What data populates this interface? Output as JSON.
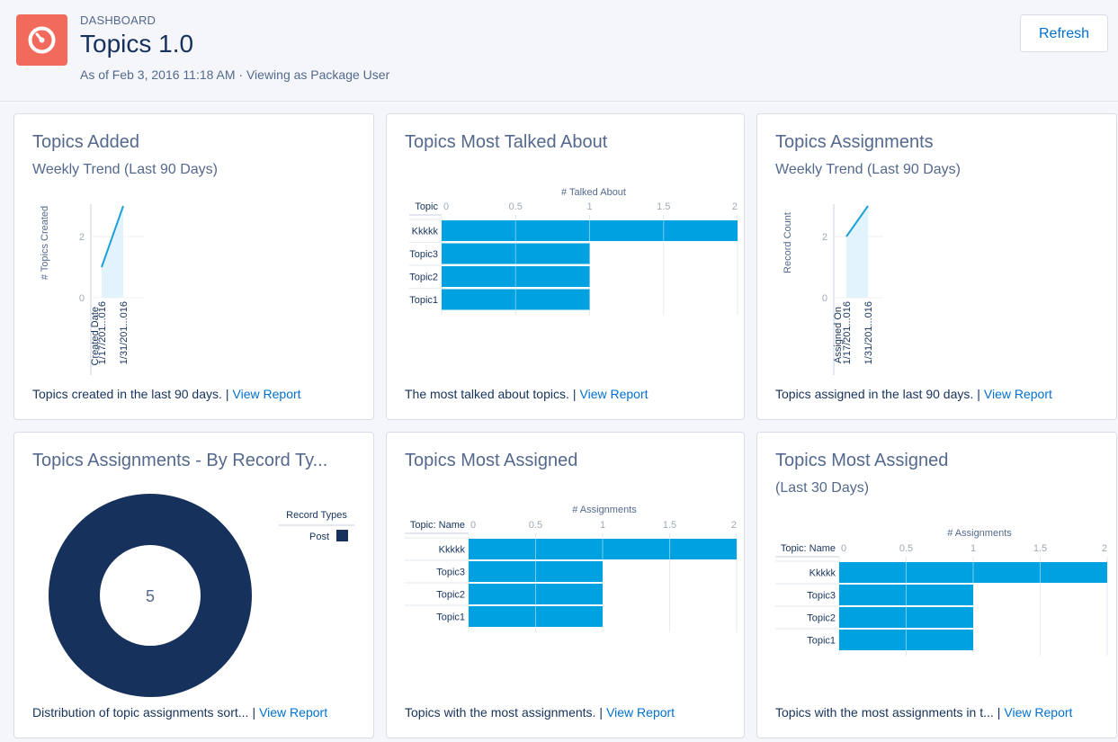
{
  "header": {
    "label": "DASHBOARD",
    "title": "Topics 1.0",
    "subtitle": "As of Feb 3, 2016 11:18 AM · Viewing as Package User",
    "refresh_label": "Refresh"
  },
  "cards": [
    {
      "title": "Topics Added",
      "subtitle": "Weekly Trend (Last 90 Days)",
      "footer_text": "Topics created in the last 90 days.",
      "footer_link": "View Report",
      "chart_data": {
        "type": "area",
        "ylabel": "# Topics Created",
        "xlabel": "Created Date",
        "categories": [
          "1/17/201...016",
          "1/31/201...016"
        ],
        "values": [
          1,
          3
        ],
        "ylim": [
          0,
          3
        ],
        "yticks": [
          "0",
          "2"
        ]
      }
    },
    {
      "title": "Topics Most Talked About",
      "footer_text": "The most talked about topics.",
      "footer_link": "View Report",
      "chart_data": {
        "type": "bar",
        "orientation": "horizontal",
        "xlabel": "# Talked About",
        "category_header": "Topic",
        "categories": [
          "Kkkkk",
          "Topic3",
          "Topic2",
          "Topic1"
        ],
        "values": [
          2,
          1,
          1,
          1
        ],
        "xlim": [
          0,
          2
        ],
        "xticks": [
          "0",
          "0.5",
          "1",
          "1.5",
          "2"
        ]
      }
    },
    {
      "title": "Topics Assignments",
      "subtitle": "Weekly Trend (Last 90 Days)",
      "footer_text": "Topics assigned in the last 90 days.",
      "footer_link": "View Report",
      "chart_data": {
        "type": "area",
        "ylabel": "Record Count",
        "xlabel": "Assigned On",
        "categories": [
          "1/17/201...016",
          "1/31/201...016"
        ],
        "values": [
          2,
          3
        ],
        "ylim": [
          0,
          3
        ],
        "yticks": [
          "0",
          "2"
        ]
      }
    },
    {
      "title": "Topics Assignments - By Record Ty...",
      "footer_text": "Distribution of topic assignments sort...",
      "footer_link": "View Report",
      "chart_data": {
        "type": "pie",
        "donut": true,
        "center_label": "5",
        "legend_title": "Record Types",
        "labels": [
          "Post"
        ],
        "values": [
          5
        ],
        "colors": [
          "#16325c"
        ]
      }
    },
    {
      "title": "Topics Most Assigned",
      "footer_text": "Topics with the most assignments.",
      "footer_link": "View Report",
      "chart_data": {
        "type": "bar",
        "orientation": "horizontal",
        "xlabel": "# Assignments",
        "category_header": "Topic: Name",
        "categories": [
          "Kkkkk",
          "Topic3",
          "Topic2",
          "Topic1"
        ],
        "values": [
          2,
          1,
          1,
          1
        ],
        "xlim": [
          0,
          2
        ],
        "xticks": [
          "0",
          "0.5",
          "1",
          "1.5",
          "2"
        ]
      }
    },
    {
      "title": "Topics Most Assigned",
      "subtitle": "(Last 30 Days)",
      "footer_text": "Topics with the most assignments in t...",
      "footer_link": "View Report",
      "chart_data": {
        "type": "bar",
        "orientation": "horizontal",
        "xlabel": "# Assignments",
        "category_header": "Topic: Name",
        "categories": [
          "Kkkkk",
          "Topic3",
          "Topic2",
          "Topic1"
        ],
        "values": [
          2,
          1,
          1,
          1
        ],
        "xlim": [
          0,
          2
        ],
        "xticks": [
          "0",
          "0.5",
          "1",
          "1.5",
          "2"
        ]
      }
    }
  ],
  "colors": {
    "accent": "#0070d2",
    "bar": "#00a1e0",
    "icon_bg": "#f26a5c",
    "area_fill": "#e3f3fc",
    "line": "#1ba1d9",
    "donut": "#16325c"
  },
  "icons": [
    "dashboard-gauge-icon"
  ]
}
